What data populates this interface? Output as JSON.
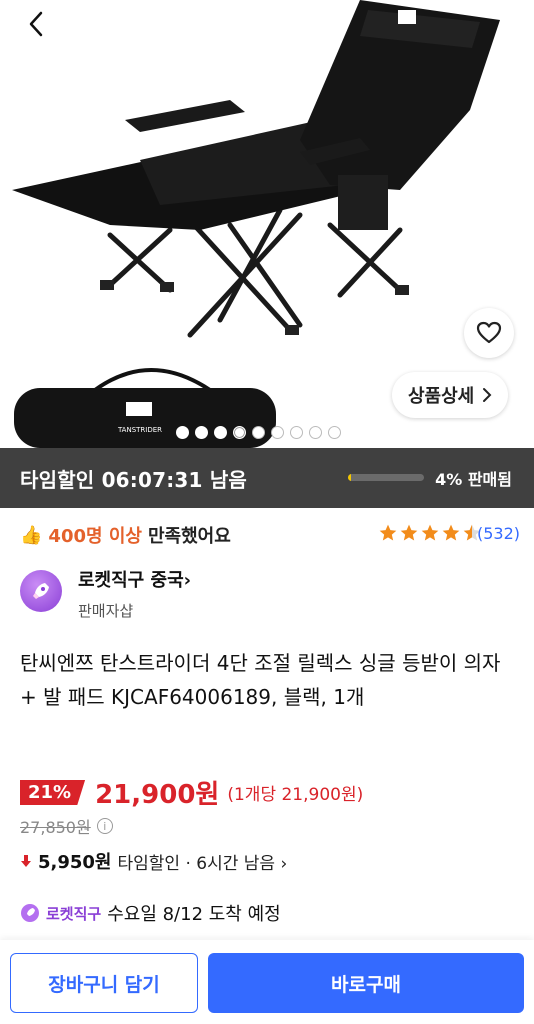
{
  "hero": {
    "bag_brand": "TANSTRIDER",
    "detail_button_label": "상품상세",
    "image_count": 9,
    "active_image_index": 3
  },
  "time_sale": {
    "label": "타임할인 06:07:31 남음",
    "sold_percent_text": "4% 판매됨",
    "sold_fraction": 0.04,
    "accent_color": "#f3c600"
  },
  "satisfaction": {
    "count": "400명 이상",
    "text": "만족했어요",
    "rating": 4.5,
    "review_count": "(532)"
  },
  "seller": {
    "name": "로켓직구 중국",
    "chevron": "›",
    "subtitle": "판매자샵"
  },
  "product": {
    "title": "탄씨엔쯔 탄스트라이더 4단 조절 릴렉스 싱글 등받이 의자 + 발 패드 KJCAF64006189, 블랙, 1개"
  },
  "price": {
    "discount": "21%",
    "sale_price": "21,900원",
    "unit_price": "(1개당 21,900원)",
    "original_price": "27,850원",
    "time_discount_amount": "5,950원",
    "time_discount_text": "타임할인 · 6시간 남음  ›",
    "accent_color": "#d9232a"
  },
  "delivery": {
    "badge": "로켓직구",
    "text": "수요일 8/12 도착 예정"
  },
  "bottom_bar": {
    "cart_label": "장바구니 담기",
    "buy_label": "바로구매",
    "accent_color": "#346aff"
  }
}
